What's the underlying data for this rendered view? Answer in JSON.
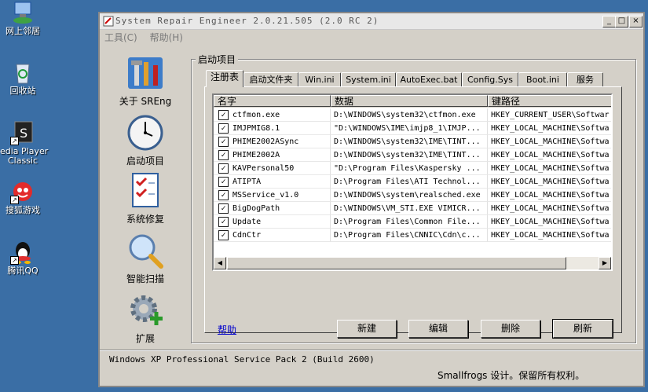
{
  "desktop": {
    "icons": [
      {
        "label": "网上邻居",
        "icon": "network-icon"
      },
      {
        "label": "回收站",
        "icon": "recycle-bin-icon"
      },
      {
        "label": "edia Player",
        "label2": "Classic",
        "icon": "media-player-icon"
      },
      {
        "label": "搜狐游戏",
        "icon": "sohu-game-icon"
      },
      {
        "label": "腾讯QQ",
        "icon": "qq-icon"
      }
    ]
  },
  "window": {
    "title": "System Repair Engineer 2.0.21.505 (2.0 RC 2)",
    "menu": [
      "工具(C)",
      "帮助(H)"
    ],
    "title_buttons": {
      "minimize": "_",
      "maximize": "□",
      "close": "×"
    }
  },
  "nav": [
    {
      "label": "关于 SREng",
      "icon": "tools-icon"
    },
    {
      "label": "启动项目",
      "icon": "clock-icon"
    },
    {
      "label": "系统修复",
      "icon": "checklist-icon"
    },
    {
      "label": "智能扫描",
      "icon": "magnifier-icon"
    },
    {
      "label": "扩展",
      "icon": "gear-plus-icon"
    }
  ],
  "group_title": "启动项目",
  "tabs": [
    "注册表",
    "启动文件夹",
    "Win.ini",
    "System.ini",
    "AutoExec.bat",
    "Config.Sys",
    "Boot.ini",
    "服务"
  ],
  "active_tab": 0,
  "table": {
    "columns": [
      "名字",
      "数据",
      "键路径"
    ],
    "rows": [
      {
        "checked": true,
        "name": "ctfmon.exe",
        "data": "D:\\WINDOWS\\system32\\ctfmon.exe",
        "path": "HKEY_CURRENT_USER\\Softwar"
      },
      {
        "checked": true,
        "name": "IMJPMIG8.1",
        "data": "\"D:\\WINDOWS\\IME\\imjp8_1\\IMJP...",
        "path": "HKEY_LOCAL_MACHINE\\Softwa"
      },
      {
        "checked": true,
        "name": "PHIME2002ASync",
        "data": "D:\\WINDOWS\\system32\\IME\\TINT...",
        "path": "HKEY_LOCAL_MACHINE\\Softwa"
      },
      {
        "checked": true,
        "name": "PHIME2002A",
        "data": "D:\\WINDOWS\\system32\\IME\\TINT...",
        "path": "HKEY_LOCAL_MACHINE\\Softwa"
      },
      {
        "checked": true,
        "name": "KAVPersonal50",
        "data": "\"D:\\Program Files\\Kaspersky ...",
        "path": "HKEY_LOCAL_MACHINE\\Softwa"
      },
      {
        "checked": true,
        "name": "ATIPTA",
        "data": "D:\\Program Files\\ATI Technol...",
        "path": "HKEY_LOCAL_MACHINE\\Softwa"
      },
      {
        "checked": true,
        "name": "MSService_v1.0",
        "data": "D:\\WINDOWS\\system\\realsched.exe",
        "path": "HKEY_LOCAL_MACHINE\\Softwa"
      },
      {
        "checked": true,
        "name": "BigDogPath",
        "data": "D:\\WINDOWS\\VM_STI.EXE VIMICR...",
        "path": "HKEY_LOCAL_MACHINE\\Softwa"
      },
      {
        "checked": true,
        "name": "Update",
        "data": "D:\\Program Files\\Common File...",
        "path": "HKEY_LOCAL_MACHINE\\Softwa"
      },
      {
        "checked": true,
        "name": "CdnCtr",
        "data": "D:\\Program Files\\CNNIC\\Cdn\\c...",
        "path": "HKEY_LOCAL_MACHINE\\Softwa"
      }
    ]
  },
  "buttons": {
    "help": "帮助",
    "new": "新建",
    "edit": "编辑",
    "delete": "删除",
    "refresh": "刷新"
  },
  "status": {
    "os": "Windows XP Professional Service Pack 2 (Build 2600)",
    "copyright": "Smallfrogs 设计。保留所有权利。"
  }
}
